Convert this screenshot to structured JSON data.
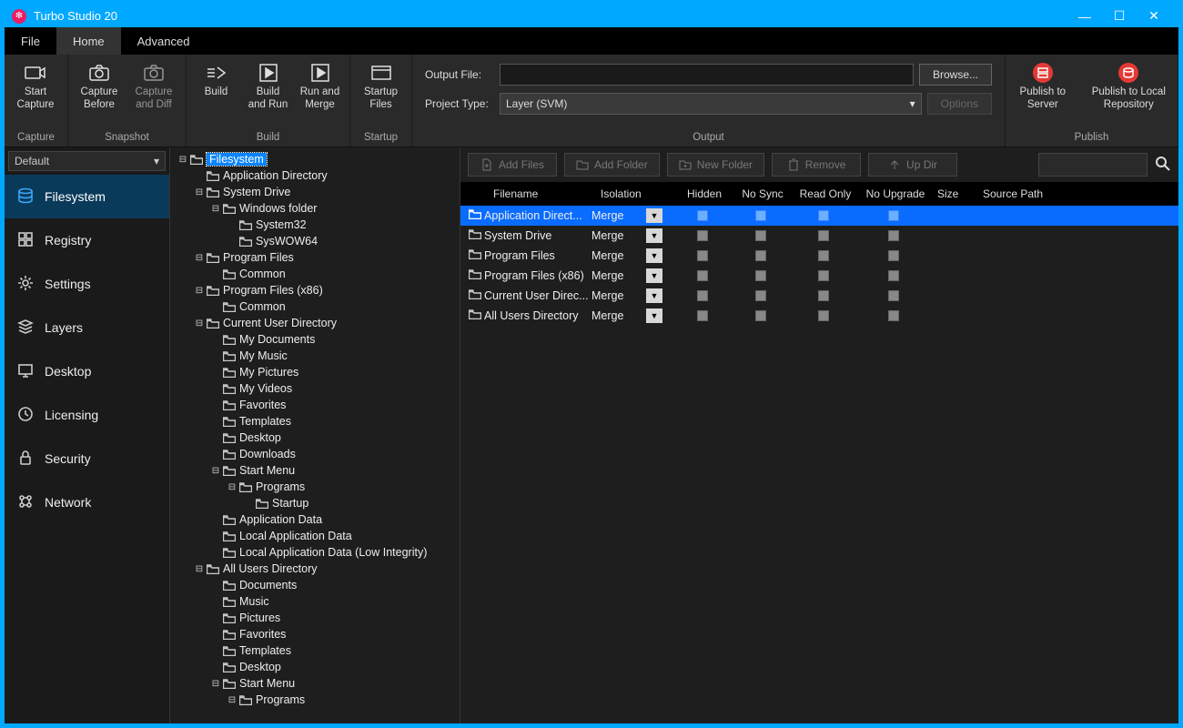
{
  "app": {
    "title": "Turbo Studio 20"
  },
  "menu": {
    "file": "File",
    "home": "Home",
    "advanced": "Advanced"
  },
  "ribbon": {
    "capture": {
      "label": "Capture",
      "start": "Start\nCapture"
    },
    "snapshot": {
      "label": "Snapshot",
      "before": "Capture\nBefore",
      "diff": "Capture\nand Diff"
    },
    "build": {
      "label": "Build",
      "build": "Build",
      "run": "Build\nand Run",
      "merge": "Run and\nMerge"
    },
    "startup": {
      "label": "Startup",
      "files": "Startup\nFiles"
    },
    "output": {
      "label": "Output",
      "outputFileLabel": "Output File:",
      "outputFileValue": "",
      "browse": "Browse...",
      "projectTypeLabel": "Project Type:",
      "projectTypeValue": "Layer (SVM)",
      "options": "Options"
    },
    "publish": {
      "label": "Publish",
      "server": "Publish to\nServer",
      "local": "Publish to Local\nRepository"
    }
  },
  "sidebar": {
    "profile": "Default",
    "items": [
      {
        "label": "Filesystem"
      },
      {
        "label": "Registry"
      },
      {
        "label": "Settings"
      },
      {
        "label": "Layers"
      },
      {
        "label": "Desktop"
      },
      {
        "label": "Licensing"
      },
      {
        "label": "Security"
      },
      {
        "label": "Network"
      }
    ]
  },
  "tree": [
    {
      "d": 0,
      "tw": "-",
      "label": "Filesystem",
      "sel": true
    },
    {
      "d": 1,
      "tw": "",
      "label": "Application Directory"
    },
    {
      "d": 1,
      "tw": "-",
      "label": "System Drive"
    },
    {
      "d": 2,
      "tw": "-",
      "label": "Windows folder"
    },
    {
      "d": 3,
      "tw": "",
      "label": "System32"
    },
    {
      "d": 3,
      "tw": "",
      "label": "SysWOW64"
    },
    {
      "d": 1,
      "tw": "-",
      "label": "Program Files"
    },
    {
      "d": 2,
      "tw": "",
      "label": "Common"
    },
    {
      "d": 1,
      "tw": "-",
      "label": "Program Files (x86)"
    },
    {
      "d": 2,
      "tw": "",
      "label": "Common"
    },
    {
      "d": 1,
      "tw": "-",
      "label": "Current User Directory"
    },
    {
      "d": 2,
      "tw": "",
      "label": "My Documents"
    },
    {
      "d": 2,
      "tw": "",
      "label": "My Music"
    },
    {
      "d": 2,
      "tw": "",
      "label": "My Pictures"
    },
    {
      "d": 2,
      "tw": "",
      "label": "My Videos"
    },
    {
      "d": 2,
      "tw": "",
      "label": "Favorites"
    },
    {
      "d": 2,
      "tw": "",
      "label": "Templates"
    },
    {
      "d": 2,
      "tw": "",
      "label": "Desktop"
    },
    {
      "d": 2,
      "tw": "",
      "label": "Downloads"
    },
    {
      "d": 2,
      "tw": "-",
      "label": "Start Menu"
    },
    {
      "d": 3,
      "tw": "-",
      "label": "Programs"
    },
    {
      "d": 4,
      "tw": "",
      "label": "Startup"
    },
    {
      "d": 2,
      "tw": "",
      "label": "Application Data"
    },
    {
      "d": 2,
      "tw": "",
      "label": "Local Application Data"
    },
    {
      "d": 2,
      "tw": "",
      "label": "Local Application Data (Low Integrity)"
    },
    {
      "d": 1,
      "tw": "-",
      "label": "All Users Directory"
    },
    {
      "d": 2,
      "tw": "",
      "label": "Documents"
    },
    {
      "d": 2,
      "tw": "",
      "label": "Music"
    },
    {
      "d": 2,
      "tw": "",
      "label": "Pictures"
    },
    {
      "d": 2,
      "tw": "",
      "label": "Favorites"
    },
    {
      "d": 2,
      "tw": "",
      "label": "Templates"
    },
    {
      "d": 2,
      "tw": "",
      "label": "Desktop"
    },
    {
      "d": 2,
      "tw": "-",
      "label": "Start Menu"
    },
    {
      "d": 3,
      "tw": "-",
      "label": "Programs"
    }
  ],
  "toolbar": {
    "addFiles": "Add Files",
    "addFolder": "Add Folder",
    "newFolder": "New Folder",
    "remove": "Remove",
    "upDir": "Up Dir"
  },
  "grid": {
    "cols": {
      "filename": "Filename",
      "isolation": "Isolation",
      "hidden": "Hidden",
      "nosync": "No Sync",
      "readonly": "Read Only",
      "noupgrade": "No Upgrade",
      "size": "Size",
      "source": "Source Path"
    },
    "rows": [
      {
        "name": "Application Direct...",
        "iso": "Merge",
        "sel": true
      },
      {
        "name": "System Drive",
        "iso": "Merge"
      },
      {
        "name": "Program Files",
        "iso": "Merge"
      },
      {
        "name": "Program Files (x86)",
        "iso": "Merge"
      },
      {
        "name": "Current User Direc...",
        "iso": "Merge"
      },
      {
        "name": "All Users Directory",
        "iso": "Merge"
      }
    ]
  }
}
